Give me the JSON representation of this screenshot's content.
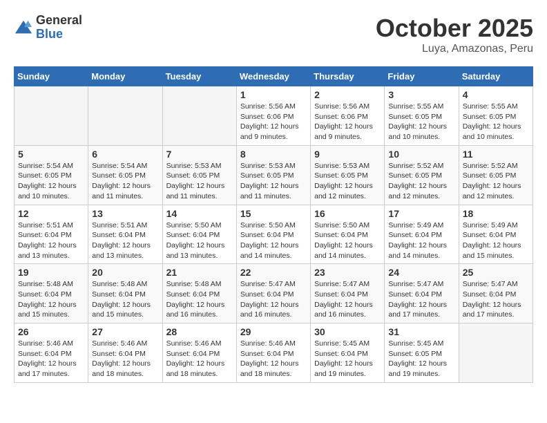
{
  "header": {
    "logo_general": "General",
    "logo_blue": "Blue",
    "month": "October 2025",
    "location": "Luya, Amazonas, Peru"
  },
  "weekdays": [
    "Sunday",
    "Monday",
    "Tuesday",
    "Wednesday",
    "Thursday",
    "Friday",
    "Saturday"
  ],
  "weeks": [
    [
      {
        "day": "",
        "info": ""
      },
      {
        "day": "",
        "info": ""
      },
      {
        "day": "",
        "info": ""
      },
      {
        "day": "1",
        "info": "Sunrise: 5:56 AM\nSunset: 6:06 PM\nDaylight: 12 hours and 9 minutes."
      },
      {
        "day": "2",
        "info": "Sunrise: 5:56 AM\nSunset: 6:06 PM\nDaylight: 12 hours and 9 minutes."
      },
      {
        "day": "3",
        "info": "Sunrise: 5:55 AM\nSunset: 6:05 PM\nDaylight: 12 hours and 10 minutes."
      },
      {
        "day": "4",
        "info": "Sunrise: 5:55 AM\nSunset: 6:05 PM\nDaylight: 12 hours and 10 minutes."
      }
    ],
    [
      {
        "day": "5",
        "info": "Sunrise: 5:54 AM\nSunset: 6:05 PM\nDaylight: 12 hours and 10 minutes."
      },
      {
        "day": "6",
        "info": "Sunrise: 5:54 AM\nSunset: 6:05 PM\nDaylight: 12 hours and 11 minutes."
      },
      {
        "day": "7",
        "info": "Sunrise: 5:53 AM\nSunset: 6:05 PM\nDaylight: 12 hours and 11 minutes."
      },
      {
        "day": "8",
        "info": "Sunrise: 5:53 AM\nSunset: 6:05 PM\nDaylight: 12 hours and 11 minutes."
      },
      {
        "day": "9",
        "info": "Sunrise: 5:53 AM\nSunset: 6:05 PM\nDaylight: 12 hours and 12 minutes."
      },
      {
        "day": "10",
        "info": "Sunrise: 5:52 AM\nSunset: 6:05 PM\nDaylight: 12 hours and 12 minutes."
      },
      {
        "day": "11",
        "info": "Sunrise: 5:52 AM\nSunset: 6:05 PM\nDaylight: 12 hours and 12 minutes."
      }
    ],
    [
      {
        "day": "12",
        "info": "Sunrise: 5:51 AM\nSunset: 6:04 PM\nDaylight: 12 hours and 13 minutes."
      },
      {
        "day": "13",
        "info": "Sunrise: 5:51 AM\nSunset: 6:04 PM\nDaylight: 12 hours and 13 minutes."
      },
      {
        "day": "14",
        "info": "Sunrise: 5:50 AM\nSunset: 6:04 PM\nDaylight: 12 hours and 13 minutes."
      },
      {
        "day": "15",
        "info": "Sunrise: 5:50 AM\nSunset: 6:04 PM\nDaylight: 12 hours and 14 minutes."
      },
      {
        "day": "16",
        "info": "Sunrise: 5:50 AM\nSunset: 6:04 PM\nDaylight: 12 hours and 14 minutes."
      },
      {
        "day": "17",
        "info": "Sunrise: 5:49 AM\nSunset: 6:04 PM\nDaylight: 12 hours and 14 minutes."
      },
      {
        "day": "18",
        "info": "Sunrise: 5:49 AM\nSunset: 6:04 PM\nDaylight: 12 hours and 15 minutes."
      }
    ],
    [
      {
        "day": "19",
        "info": "Sunrise: 5:48 AM\nSunset: 6:04 PM\nDaylight: 12 hours and 15 minutes."
      },
      {
        "day": "20",
        "info": "Sunrise: 5:48 AM\nSunset: 6:04 PM\nDaylight: 12 hours and 15 minutes."
      },
      {
        "day": "21",
        "info": "Sunrise: 5:48 AM\nSunset: 6:04 PM\nDaylight: 12 hours and 16 minutes."
      },
      {
        "day": "22",
        "info": "Sunrise: 5:47 AM\nSunset: 6:04 PM\nDaylight: 12 hours and 16 minutes."
      },
      {
        "day": "23",
        "info": "Sunrise: 5:47 AM\nSunset: 6:04 PM\nDaylight: 12 hours and 16 minutes."
      },
      {
        "day": "24",
        "info": "Sunrise: 5:47 AM\nSunset: 6:04 PM\nDaylight: 12 hours and 17 minutes."
      },
      {
        "day": "25",
        "info": "Sunrise: 5:47 AM\nSunset: 6:04 PM\nDaylight: 12 hours and 17 minutes."
      }
    ],
    [
      {
        "day": "26",
        "info": "Sunrise: 5:46 AM\nSunset: 6:04 PM\nDaylight: 12 hours and 17 minutes."
      },
      {
        "day": "27",
        "info": "Sunrise: 5:46 AM\nSunset: 6:04 PM\nDaylight: 12 hours and 18 minutes."
      },
      {
        "day": "28",
        "info": "Sunrise: 5:46 AM\nSunset: 6:04 PM\nDaylight: 12 hours and 18 minutes."
      },
      {
        "day": "29",
        "info": "Sunrise: 5:46 AM\nSunset: 6:04 PM\nDaylight: 12 hours and 18 minutes."
      },
      {
        "day": "30",
        "info": "Sunrise: 5:45 AM\nSunset: 6:04 PM\nDaylight: 12 hours and 19 minutes."
      },
      {
        "day": "31",
        "info": "Sunrise: 5:45 AM\nSunset: 6:05 PM\nDaylight: 12 hours and 19 minutes."
      },
      {
        "day": "",
        "info": ""
      }
    ]
  ]
}
